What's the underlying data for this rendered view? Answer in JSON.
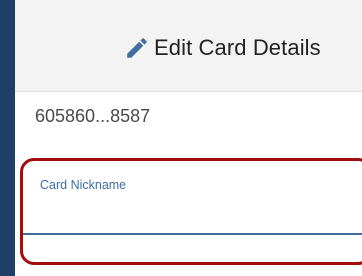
{
  "header": {
    "icon": "pencil-icon",
    "title": "Edit Card Details"
  },
  "card": {
    "number_masked": "605860...8587"
  },
  "nickname_field": {
    "label": "Card Nickname",
    "value": ""
  },
  "colors": {
    "accent": "#3f6ea3",
    "highlight_border": "#a50d0d",
    "nav_border": "#1f3f68"
  }
}
